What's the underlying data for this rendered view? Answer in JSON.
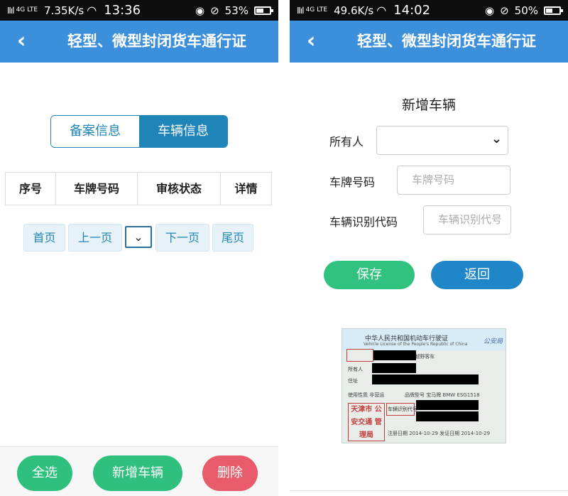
{
  "screen1": {
    "status": {
      "signal": "Ⅱıl",
      "network": "4G LTE",
      "speed": "7.35K/s",
      "time": "13:36",
      "battery": "53%",
      "battery_fill": 0.53
    },
    "title": "轻型、微型封闭货车通行证",
    "tabs": [
      {
        "label": "备案信息",
        "active": false
      },
      {
        "label": "车辆信息",
        "active": true
      }
    ],
    "table_headers": [
      "序号",
      "车牌号码",
      "审核状态",
      "详情"
    ],
    "pagination": {
      "first": "首页",
      "prev": "上一页",
      "next": "下一页",
      "last": "尾页"
    },
    "actions": {
      "select_all": "全选",
      "add_vehicle": "新增车辆",
      "delete": "删除"
    }
  },
  "screen2": {
    "status": {
      "signal": "Ⅱıl",
      "network": "4G LTE",
      "speed": "49.6K/s",
      "time": "14:02",
      "battery": "50%",
      "battery_fill": 0.5
    },
    "title": "轻型、微型封闭货车通行证",
    "form_title": "新增车辆",
    "fields": {
      "owner_label": "所有人",
      "plate_label": "车牌号码",
      "plate_placeholder": "车牌号码",
      "vin_label": "车辆识别代码",
      "vin_placeholder": "车辆识别代号"
    },
    "buttons": {
      "save": "保存",
      "back": "返回"
    },
    "license_image": {
      "heading": "中华人民共和国机动车行驶证",
      "subheading": "Vehicle License of the People's Republic of China",
      "vehicle_type": "车辆类型 小型越野客车",
      "brand_model": "品牌型号 宝马牌 BMW ESG1518",
      "use_character": "使用性质 非营运",
      "owner_label": "所有人",
      "address_label": "住址",
      "vin_label": "车辆识别代号",
      "dates": "注册日期 2014-10-29  发证日期 2014-10-29",
      "stamp": "天津市 公安交通 管理局",
      "mark": "公安局"
    }
  }
}
